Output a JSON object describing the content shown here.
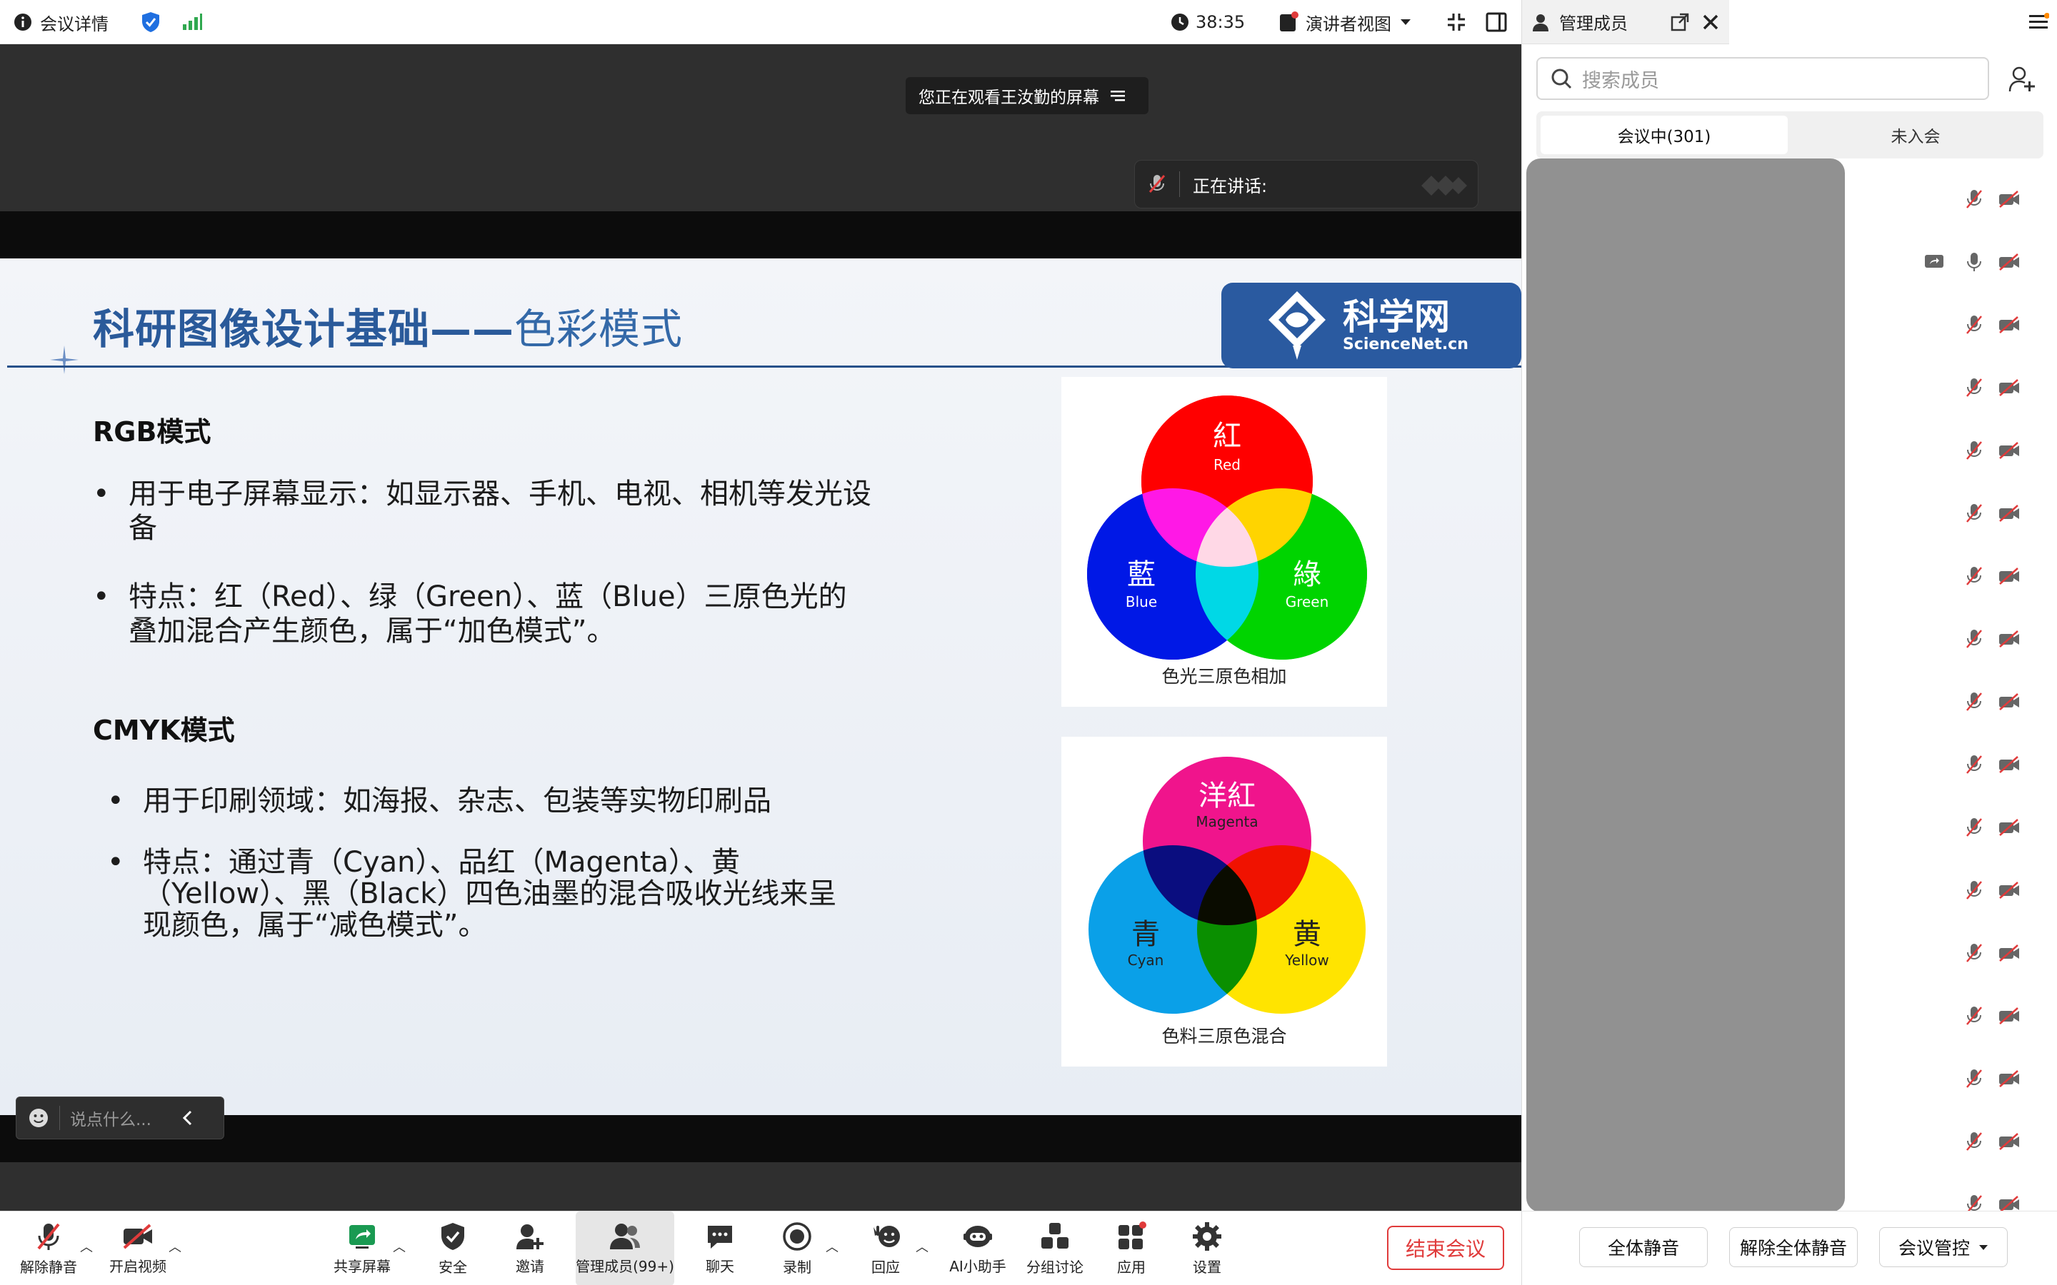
{
  "topbar": {
    "meeting_details": "会议详情",
    "timer": "38:35",
    "presenter_view": "演讲者视图"
  },
  "stage": {
    "notice": "您正在观看王汝勤的屏幕",
    "speaking_label": "正在讲话:"
  },
  "slide": {
    "title_main": "科研图像设计基础——",
    "title_sub": "色彩模式",
    "logo": {
      "name": "科学网",
      "domain": "ScienceNet.cn"
    },
    "rgb": {
      "heading": "RGB模式",
      "bullets": [
        [
          "用于电子屏幕显示：如显示器、手机、电视、相机等发光设",
          "备"
        ],
        [
          "特点：红（Red）、绿（Green）、蓝（Blue）三原色光的",
          "叠加混合产生颜色，属于“加色模式”。"
        ]
      ]
    },
    "cmyk": {
      "heading": "CMYK模式",
      "bullets": [
        [
          "用于印刷领域：如海报、杂志、包装等实物印刷品"
        ],
        [
          "特点：通过青（Cyan）、品红（Magenta）、黄",
          "（Yellow）、黑（Black）四色油墨的混合吸收光线来呈",
          "现颜色，属于“减色模式”。"
        ]
      ]
    },
    "rgb_diagram": {
      "red_cn": "紅",
      "red_en": "Red",
      "blue_cn": "藍",
      "blue_en": "Blue",
      "green_cn": "綠",
      "green_en": "Green",
      "caption": "色光三原色相加"
    },
    "cmy_diagram": {
      "magenta_cn": "洋紅",
      "magenta_en": "Magenta",
      "cyan_cn": "青",
      "cyan_en": "Cyan",
      "yellow_cn": "黄",
      "yellow_en": "Yellow",
      "caption": "色料三原色混合"
    }
  },
  "chat": {
    "placeholder": "说点什么..."
  },
  "toolbar": {
    "unmute": "解除静音",
    "start_video": "开启视频",
    "share_screen": "共享屏幕",
    "security": "安全",
    "invite": "邀请",
    "manage_members": "管理成员(99+)",
    "chat": "聊天",
    "record": "录制",
    "reactions": "回应",
    "ai_assistant": "AI小助手",
    "breakout": "分组讨论",
    "apps": "应用",
    "settings": "设置",
    "end_meeting": "结束会议"
  },
  "panel": {
    "title": "管理成员",
    "search_placeholder": "搜索成员",
    "tab_in_meeting": "会议中(301)",
    "tab_not_joined": "未入会",
    "mute_all": "全体静音",
    "unmute_all": "解除全体静音",
    "meeting_control": "会议管控"
  },
  "colors": {
    "accent_blue": "#2a5aa0",
    "end_red": "#e03b3b",
    "signal_green": "#2fa84f"
  }
}
